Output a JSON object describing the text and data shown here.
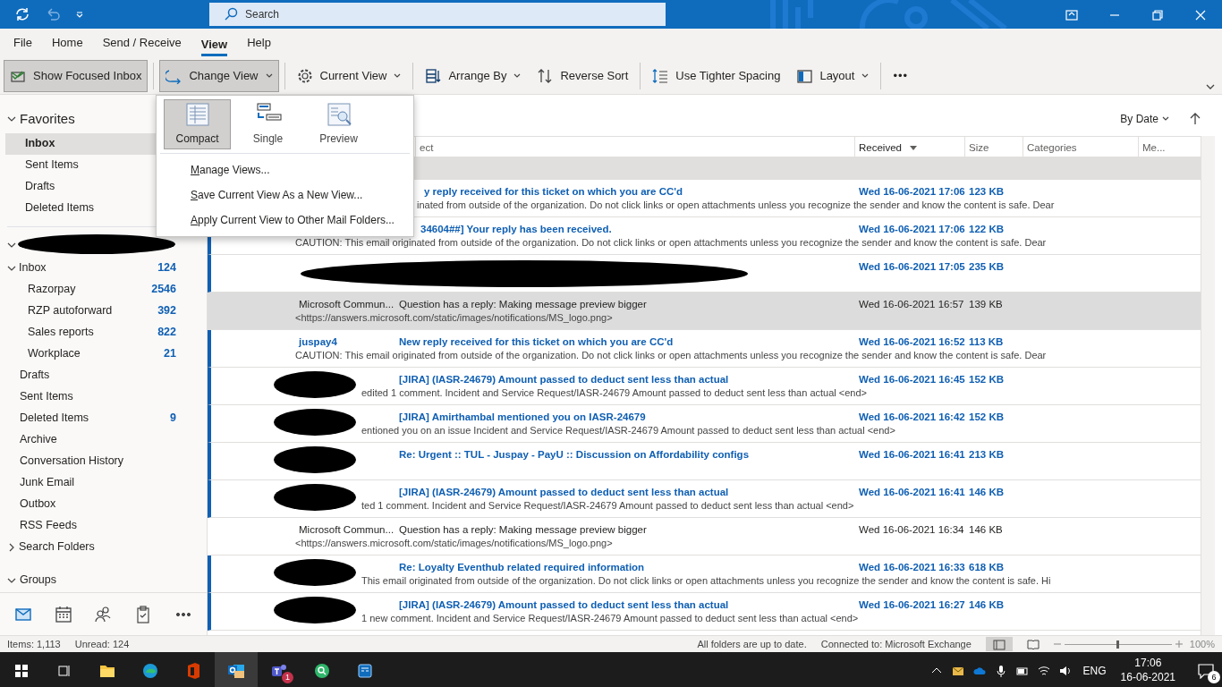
{
  "title_bar": {
    "search_placeholder": "Search"
  },
  "ribbon_tabs": [
    {
      "label": "File",
      "selected": false
    },
    {
      "label": "Home",
      "selected": false
    },
    {
      "label": "Send / Receive",
      "selected": false
    },
    {
      "label": "View",
      "selected": true
    },
    {
      "label": "Help",
      "selected": false
    }
  ],
  "toolbar": [
    {
      "kind": "focused",
      "label": "Show Focused Inbox",
      "pressed": true
    },
    {
      "kind": "changeview",
      "label": "Change View",
      "pressed": true,
      "dropdown": true
    },
    {
      "kind": "currentview",
      "label": "Current View",
      "pressed": false,
      "dropdown": true
    },
    {
      "kind": "arrange",
      "label": "Arrange By",
      "pressed": false,
      "dropdown": true
    },
    {
      "kind": "reverse",
      "label": "Reverse Sort",
      "pressed": false
    },
    {
      "kind": "spacing",
      "label": "Use Tighter Spacing",
      "pressed": false
    },
    {
      "kind": "layout",
      "label": "Layout",
      "pressed": false,
      "dropdown": true
    },
    {
      "kind": "more",
      "label": "•••",
      "pressed": false
    }
  ],
  "change_view_menu": {
    "views": [
      {
        "kind": "compact",
        "label": "Compact",
        "selected": true
      },
      {
        "kind": "single",
        "label": "Single",
        "selected": false
      },
      {
        "kind": "preview",
        "label": "Preview",
        "selected": false
      }
    ],
    "items": [
      "Manage Views...",
      "Save Current View As a New View...",
      "Apply Current View to Other Mail Folders..."
    ]
  },
  "sidebar": {
    "favorites": {
      "label": "Favorites",
      "expanded": true,
      "items": [
        {
          "label": "Inbox",
          "selected": true
        },
        {
          "label": "Sent Items",
          "selected": false
        },
        {
          "label": "Drafts",
          "selected": false
        },
        {
          "label": "Deleted Items",
          "selected": false
        }
      ]
    },
    "mailbox": {
      "expanded": true,
      "folders": [
        {
          "label": "Inbox",
          "count": "124",
          "expanded": true,
          "selected": false,
          "children": [
            {
              "label": "Razorpay",
              "count": "2546",
              "selected": false
            },
            {
              "label": "RZP autoforward",
              "count": "392",
              "selected": false
            },
            {
              "label": "Sales reports",
              "count": "822",
              "selected": false
            },
            {
              "label": "Workplace",
              "count": "21",
              "selected": false
            }
          ]
        },
        {
          "label": "Drafts",
          "selected": false
        },
        {
          "label": "Sent Items",
          "selected": false
        },
        {
          "label": "Deleted Items",
          "count": "9",
          "selected": false
        },
        {
          "label": "Archive",
          "selected": false
        },
        {
          "label": "Conversation History",
          "selected": false
        },
        {
          "label": "Junk Email",
          "selected": false
        },
        {
          "label": "Outbox",
          "selected": false
        },
        {
          "label": "RSS Feeds",
          "selected": false
        },
        {
          "label": "Search Folders",
          "expanded": false,
          "selected": false
        }
      ]
    },
    "groups": {
      "label": "Groups",
      "expanded": true
    },
    "nav": [
      {
        "kind": "mail",
        "selected": true
      },
      {
        "kind": "calendar",
        "selected": false
      },
      {
        "kind": "people",
        "selected": false
      },
      {
        "kind": "tasks",
        "selected": false
      },
      {
        "kind": "more",
        "selected": false
      }
    ]
  },
  "message_list": {
    "sort": "By Date",
    "columns": [
      {
        "label": "ect",
        "sorted": false
      },
      {
        "label": "Received",
        "sorted": true
      },
      {
        "label": "Size",
        "sorted": false
      },
      {
        "label": "Categories",
        "sorted": false
      },
      {
        "label": "Me...",
        "sorted": false
      }
    ],
    "rows": [
      {
        "kind": "covered",
        "subject": "y reply received for this ticket on which you are CC'd",
        "preview": "inated from outside of the organization. Do not click links or open attachments unless you recognize the sender and know the content is safe.   Dear",
        "received": "Wed 16-06-2021 17:06",
        "size": "123 KB",
        "unread": true,
        "selected": false
      },
      {
        "kind": "subject_covered",
        "subject": "34604##] Your reply has been received.",
        "preview": "CAUTION: This email originated from outside of the organization. Do not click links or open attachments unless you recognize the sender and know the content is safe.   Dear",
        "received": "Wed 16-06-2021 17:06",
        "size": "122 KB",
        "unread": true,
        "selected": false
      },
      {
        "kind": "redacted_wide",
        "received": "Wed 16-06-2021 17:05",
        "size": "235 KB",
        "unread": true,
        "selected": false
      },
      {
        "kind": "normal",
        "sender": "Microsoft Commun...",
        "subject": "Question has a reply: Making message preview bigger",
        "preview": "<https://answers.microsoft.com/static/images/notifications/MS_logo.png>",
        "received": "Wed 16-06-2021 16:57",
        "size": "139 KB",
        "unread": false,
        "selected": true
      },
      {
        "kind": "normal",
        "sender": "juspay4",
        "subject": "New reply received for this ticket on which you are CC'd",
        "preview": "CAUTION: This email originated from outside of the organization. Do not click links or open attachments unless you recognize the sender and know the content is safe.   Dear",
        "received": "Wed 16-06-2021 16:52",
        "size": "113 KB",
        "unread": true,
        "selected": false
      },
      {
        "kind": "redacted",
        "subject": "[JIRA] (IASR-24679) Amount passed to deduct sent less than actual",
        "preview": "edited 1 comment. Incident and Service Request/IASR-24679 Amount passed to deduct sent less than actual <end>",
        "received": "Wed 16-06-2021 16:45",
        "size": "152 KB",
        "unread": true,
        "selected": false
      },
      {
        "kind": "redacted",
        "subject": "[JIRA] Amirthambal mentioned you on IASR-24679",
        "preview": "entioned you on an issue  Incident and Service Request/IASR-24679 Amount passed to deduct sent less than actual <end>",
        "received": "Wed 16-06-2021 16:42",
        "size": "152 KB",
        "unread": true,
        "selected": false
      },
      {
        "kind": "redacted",
        "subject": "Re: Urgent :: TUL - Juspay - PayU :: Discussion on Affordability configs",
        "received": "Wed 16-06-2021 16:41",
        "size": "213 KB",
        "unread": true,
        "selected": false
      },
      {
        "kind": "redacted",
        "subject": "[JIRA] (IASR-24679) Amount passed to deduct sent less than actual",
        "preview": "ted 1 comment. Incident and Service Request/IASR-24679 Amount passed to deduct sent less than actual <end>",
        "received": "Wed 16-06-2021 16:41",
        "size": "146 KB",
        "unread": true,
        "selected": false
      },
      {
        "kind": "normal",
        "sender": "Microsoft Commun...",
        "subject": "Question has a reply: Making message preview bigger",
        "preview": "<https://answers.microsoft.com/static/images/notifications/MS_logo.png>",
        "received": "Wed 16-06-2021 16:34",
        "size": "146 KB",
        "unread": false,
        "selected": false
      },
      {
        "kind": "redacted",
        "subject": "Re: Loyalty Eventhub related required information",
        "preview": "This email originated from outside of the organization. Do not click links or open attachments unless you recognize the sender and know the content is safe.   Hi",
        "received": "Wed 16-06-2021 16:33",
        "size": "618 KB",
        "unread": true,
        "selected": false
      },
      {
        "kind": "redacted",
        "subject": "[JIRA] (IASR-24679) Amount passed to deduct sent less than actual",
        "preview": "1 new comment. Incident and Service Request/IASR-24679 Amount passed to deduct sent less than actual <end>",
        "received": "Wed 16-06-2021 16:27",
        "size": "146 KB",
        "unread": true,
        "selected": false
      }
    ]
  },
  "status_bar": {
    "items": "Items: 1,113",
    "unread": "Unread: 124",
    "sync": "All folders are up to date.",
    "connection": "Connected to: Microsoft Exchange",
    "zoom": {
      "level": 0.5
    },
    "zoom_label": "100%"
  },
  "taskbar": {
    "apps": [
      {
        "kind": "explorer",
        "active": false
      },
      {
        "kind": "edge",
        "active": false
      },
      {
        "kind": "office",
        "active": false
      },
      {
        "kind": "outlook",
        "active": true
      },
      {
        "kind": "teams",
        "active": false,
        "badge": "1"
      },
      {
        "kind": "search",
        "active": false
      },
      {
        "kind": "defender",
        "active": false
      }
    ],
    "language": "ENG",
    "time": "17:06",
    "date": "16-06-2021",
    "notifications": "6"
  }
}
